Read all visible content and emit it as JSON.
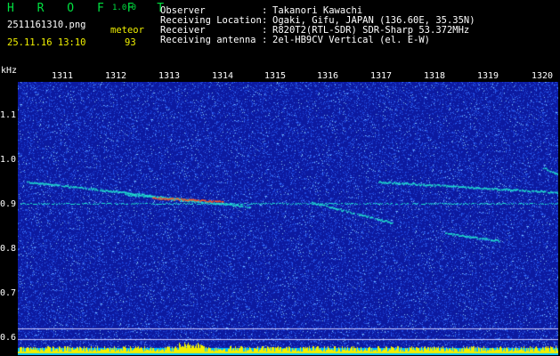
{
  "header": {
    "app_name": "H R O F F T",
    "app_version": "1.0.0",
    "file_name": "2511161310.png",
    "timestamp": "25.11.16 13:10",
    "mode_label": "meteor",
    "count": "93"
  },
  "info": {
    "rows": [
      {
        "label": "Observer",
        "sep": ":",
        "value": "Takanori Kawachi"
      },
      {
        "label": "Receiving Location",
        "sep": ":",
        "value": "Ogaki, Gifu, JAPAN (136.60E, 35.35N)"
      },
      {
        "label": "Receiver",
        "sep": ":",
        "value": "R820T2(RTL-SDR) SDR-Sharp 53.372MHz"
      },
      {
        "label": "Receiving antenna",
        "sep": ":",
        "value": "2el-HB9CV Vertical (el. E-W)"
      }
    ]
  },
  "plot": {
    "y_unit": "kHz",
    "y_ticks": [
      "1.1",
      "1.0",
      "0.9",
      "0.8",
      "0.7",
      "0.6"
    ],
    "x_ticks": [
      "1311",
      "1312",
      "1313",
      "1314",
      "1315",
      "1316",
      "1317",
      "1318",
      "1319",
      "1320"
    ],
    "colors": {
      "background": "#0c1aa0",
      "noise": "#3a78ff",
      "trace": "#20e0d0",
      "hot": "#ff5020",
      "amplitude": "#f0f000",
      "amplitude_base": "#00c0ff"
    }
  }
}
